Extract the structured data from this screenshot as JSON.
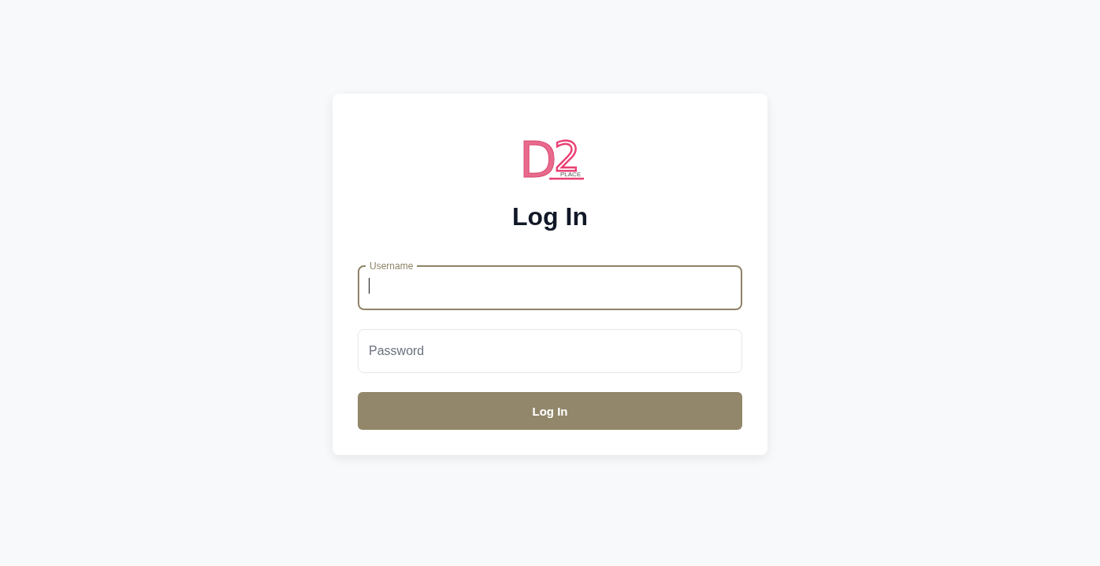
{
  "logo": {
    "letter": "D",
    "digit": "2",
    "tagline": "PLACE"
  },
  "title": "Log In",
  "fields": [
    {
      "label": "Username",
      "focused": true
    },
    {
      "placeholder": "Password",
      "focused": false
    }
  ],
  "button": "Log In"
}
